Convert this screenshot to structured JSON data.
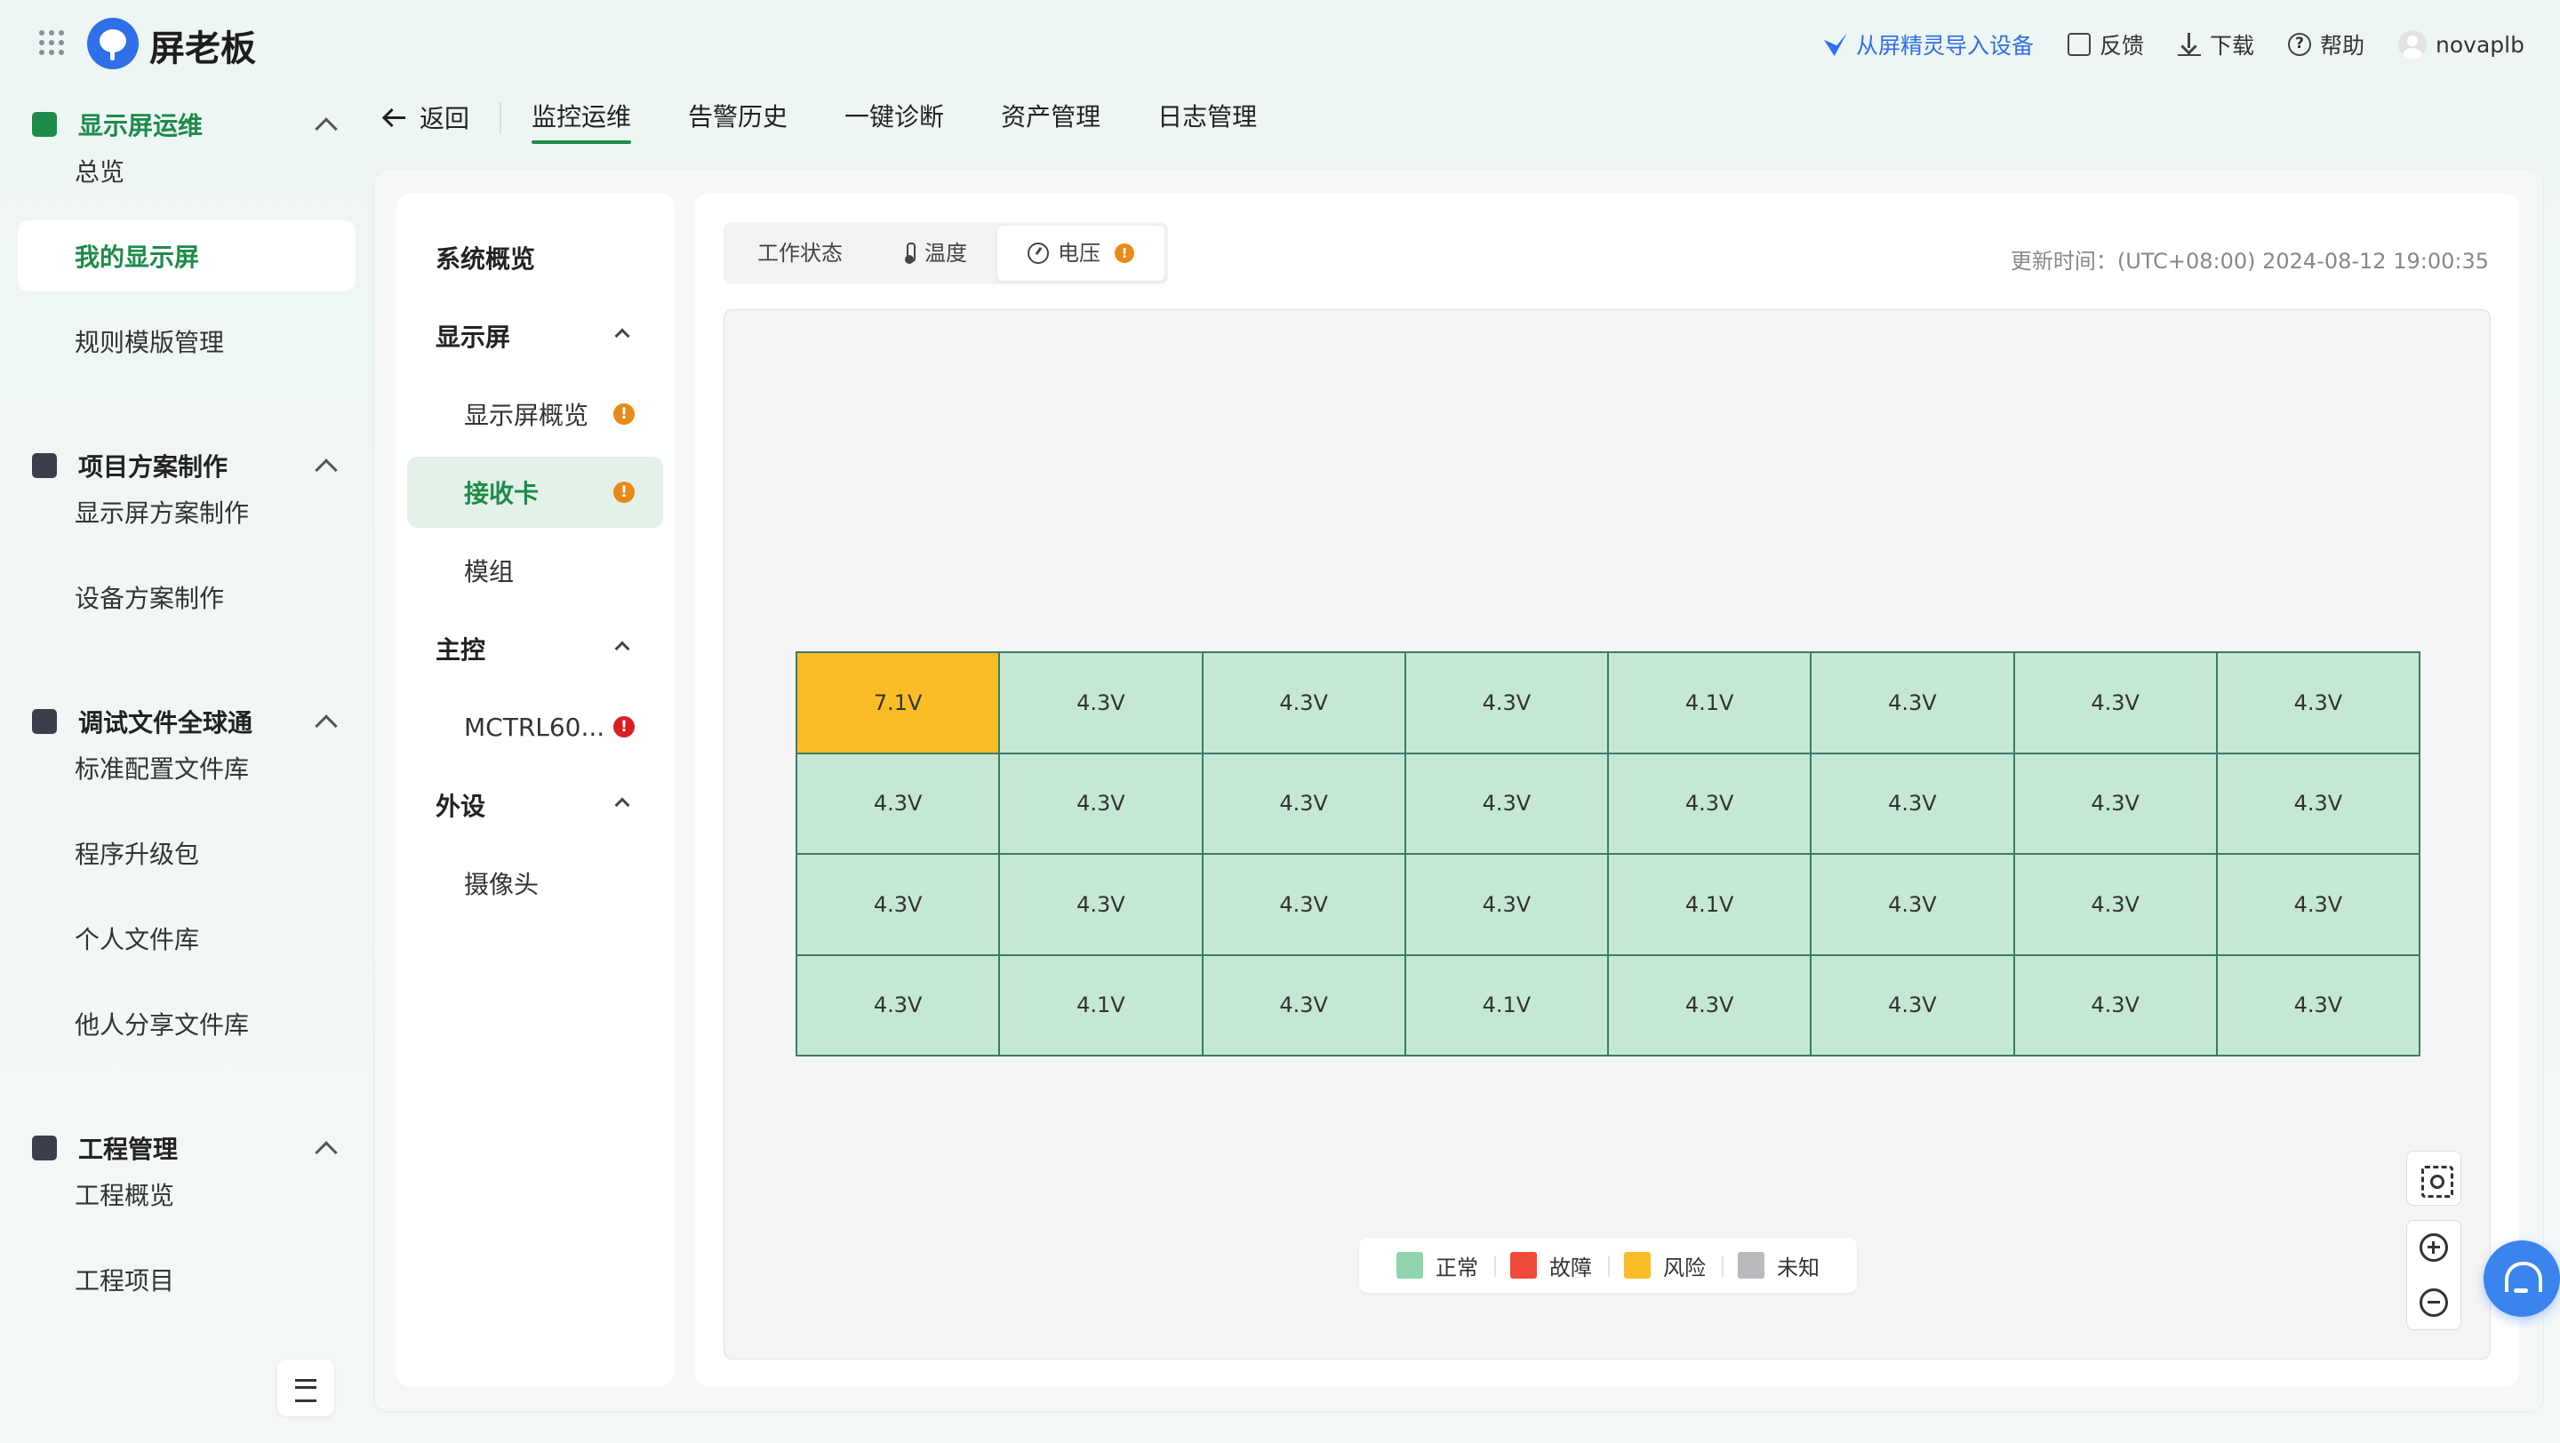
{
  "app": {
    "brand": "屏老板"
  },
  "top_actions": {
    "import": "从屏精灵导入设备",
    "feedback": "反馈",
    "download": "下载",
    "help": "帮助",
    "user": "novaplb"
  },
  "sidebar": {
    "groups": [
      {
        "label": "显示屏运维",
        "icon": "chart-icon",
        "items": [
          "总览",
          "我的显示屏",
          "规则模版管理"
        ]
      },
      {
        "label": "项目方案制作",
        "icon": "briefcase-icon",
        "items": [
          "显示屏方案制作",
          "设备方案制作"
        ]
      },
      {
        "label": "调试文件全球通",
        "icon": "folder-icon",
        "items": [
          "标准配置文件库",
          "程序升级包",
          "个人文件库",
          "他人分享文件库"
        ]
      },
      {
        "label": "工程管理",
        "icon": "grid-icon",
        "items": [
          "工程概览",
          "工程项目"
        ]
      }
    ],
    "active_item": "我的显示屏"
  },
  "nav": {
    "back": "返回",
    "tabs": [
      "监控运维",
      "告警历史",
      "一键诊断",
      "资产管理",
      "日志管理"
    ],
    "active": "监控运维"
  },
  "subnav": {
    "overview": "系统概览",
    "screen": "显示屏",
    "screen_overview": "显示屏概览",
    "receiver": "接收卡",
    "module": "模组",
    "master": "主控",
    "controller": "MCTRL60...",
    "peripheral": "外设",
    "camera": "摄像头"
  },
  "tabs": {
    "work_status": "工作状态",
    "temperature": "温度",
    "voltage": "电压",
    "active": "电压"
  },
  "updated": "更新时间：(UTC+08:00) 2024-08-12 19:00:35",
  "grid": {
    "rows": [
      [
        {
          "v": "7.1V",
          "s": "risk"
        },
        {
          "v": "4.3V",
          "s": "normal"
        },
        {
          "v": "4.3V",
          "s": "normal"
        },
        {
          "v": "4.3V",
          "s": "normal"
        },
        {
          "v": "4.1V",
          "s": "normal"
        },
        {
          "v": "4.3V",
          "s": "normal"
        },
        {
          "v": "4.3V",
          "s": "normal"
        },
        {
          "v": "4.3V",
          "s": "normal"
        }
      ],
      [
        {
          "v": "4.3V",
          "s": "normal"
        },
        {
          "v": "4.3V",
          "s": "normal"
        },
        {
          "v": "4.3V",
          "s": "normal"
        },
        {
          "v": "4.3V",
          "s": "normal"
        },
        {
          "v": "4.3V",
          "s": "normal"
        },
        {
          "v": "4.3V",
          "s": "normal"
        },
        {
          "v": "4.3V",
          "s": "normal"
        },
        {
          "v": "4.3V",
          "s": "normal"
        }
      ],
      [
        {
          "v": "4.3V",
          "s": "normal"
        },
        {
          "v": "4.3V",
          "s": "normal"
        },
        {
          "v": "4.3V",
          "s": "normal"
        },
        {
          "v": "4.3V",
          "s": "normal"
        },
        {
          "v": "4.1V",
          "s": "normal"
        },
        {
          "v": "4.3V",
          "s": "normal"
        },
        {
          "v": "4.3V",
          "s": "normal"
        },
        {
          "v": "4.3V",
          "s": "normal"
        }
      ],
      [
        {
          "v": "4.3V",
          "s": "normal"
        },
        {
          "v": "4.1V",
          "s": "normal"
        },
        {
          "v": "4.3V",
          "s": "normal"
        },
        {
          "v": "4.1V",
          "s": "normal"
        },
        {
          "v": "4.3V",
          "s": "normal"
        },
        {
          "v": "4.3V",
          "s": "normal"
        },
        {
          "v": "4.3V",
          "s": "normal"
        },
        {
          "v": "4.3V",
          "s": "normal"
        }
      ]
    ]
  },
  "legend": [
    {
      "label": "正常",
      "color": "#8fd4ac"
    },
    {
      "label": "故障",
      "color": "#ef4a3b"
    },
    {
      "label": "风险",
      "color": "#fbbd26"
    },
    {
      "label": "未知",
      "color": "#b9babd"
    }
  ],
  "colors": {
    "accent": "#1e8b49",
    "link": "#2f6fe8",
    "warning": "#e88a1a",
    "error": "#d92020"
  }
}
